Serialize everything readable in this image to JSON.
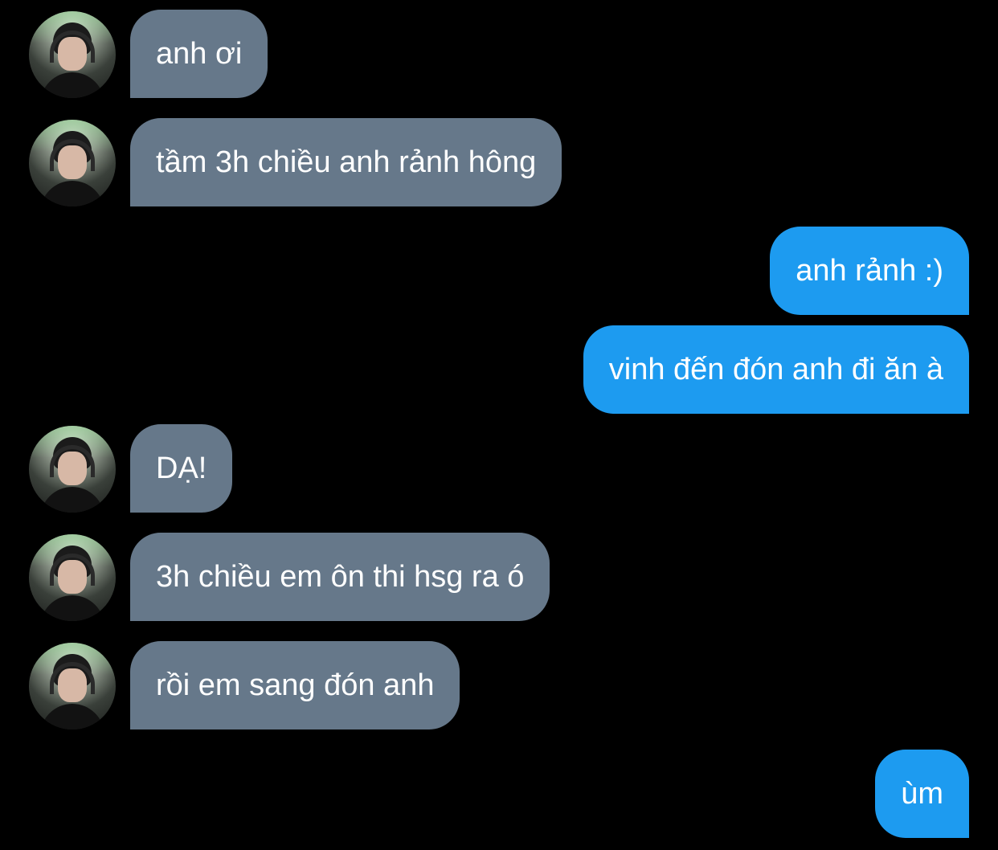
{
  "colors": {
    "background": "#000000",
    "incoming_bubble": "#66788a",
    "outgoing_bubble": "#1d9bf0",
    "text": "#ffffff"
  },
  "messages": [
    {
      "direction": "incoming",
      "text": "anh ơi"
    },
    {
      "direction": "incoming",
      "text": "tầm 3h chiều anh rảnh hông"
    },
    {
      "direction": "outgoing",
      "text": "anh rảnh :)"
    },
    {
      "direction": "outgoing",
      "text": "vinh đến đón anh đi ăn à"
    },
    {
      "direction": "incoming",
      "text": "DẠ!"
    },
    {
      "direction": "incoming",
      "text": "3h chiều em ôn thi hsg ra ó"
    },
    {
      "direction": "incoming",
      "text": "rồi em sang đón anh"
    },
    {
      "direction": "outgoing",
      "text": "ùm"
    }
  ]
}
